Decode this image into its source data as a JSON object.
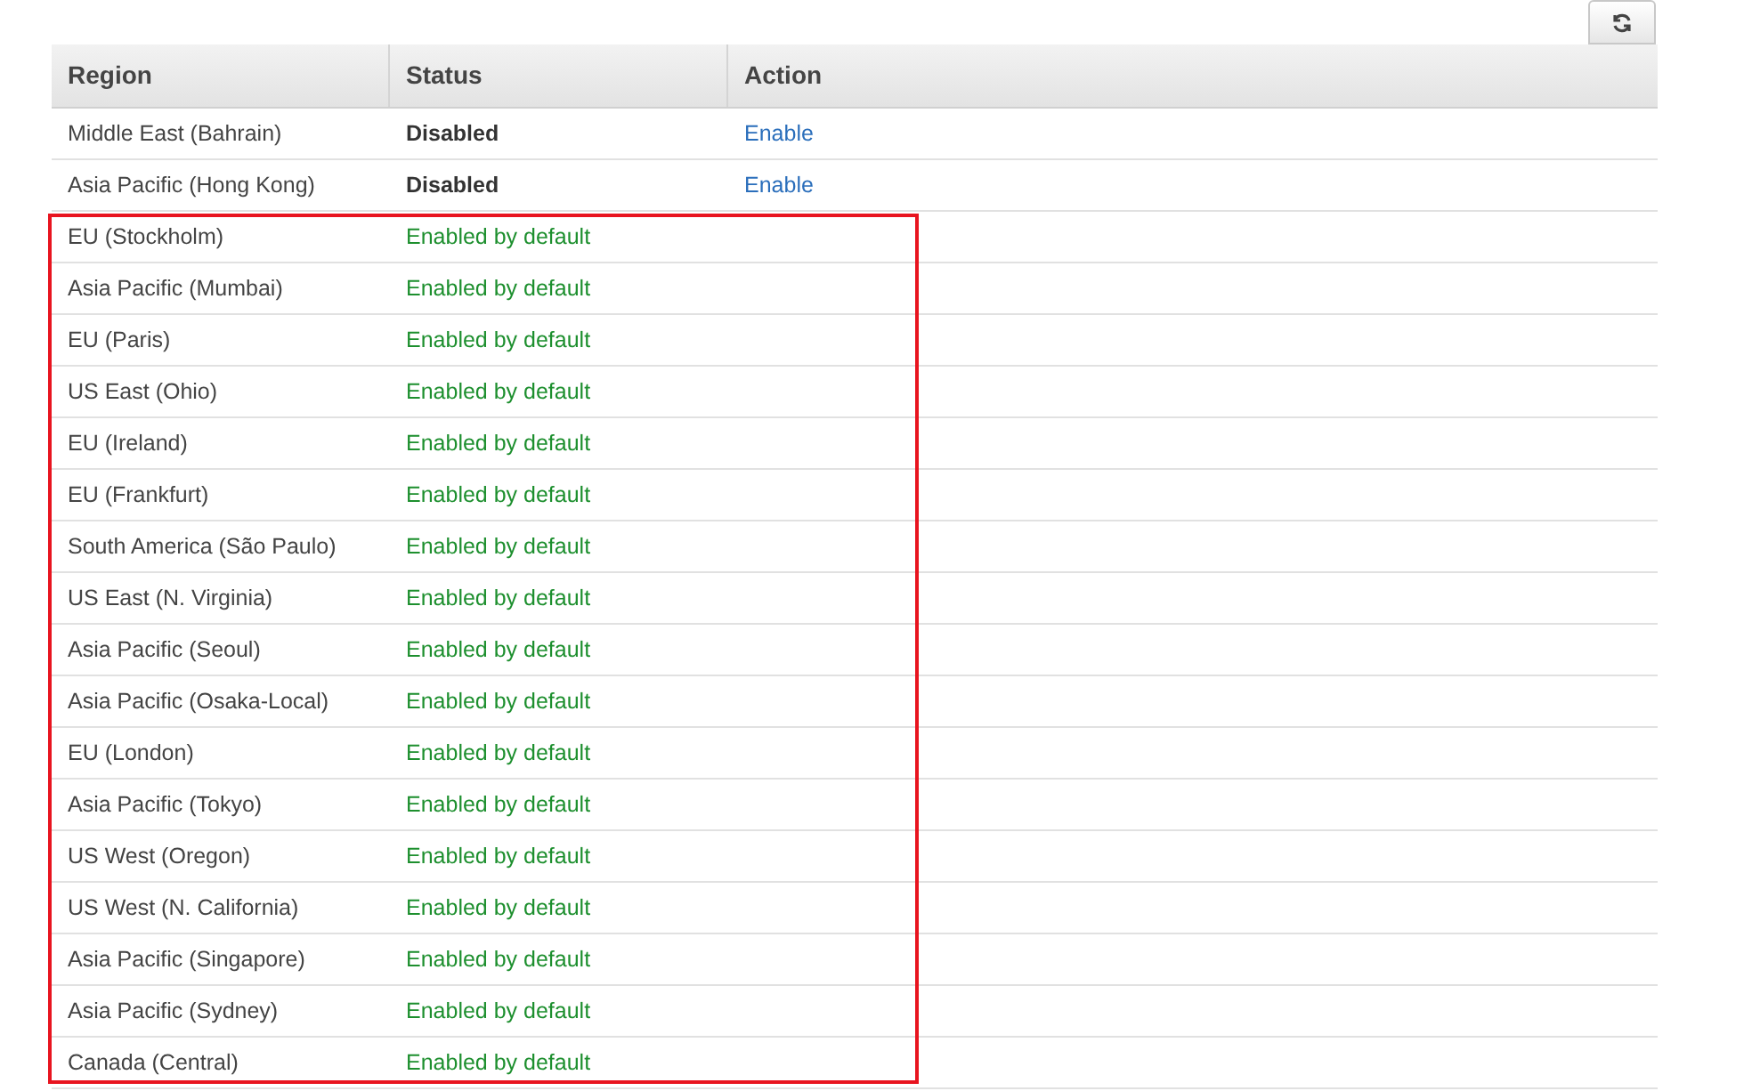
{
  "refresh_button": {
    "kind": "refresh"
  },
  "table": {
    "columns": [
      "Region",
      "Status",
      "Action"
    ],
    "rows": [
      {
        "region": "Middle East (Bahrain)",
        "status": "Disabled",
        "kind": "disabled",
        "action": "Enable"
      },
      {
        "region": "Asia Pacific (Hong Kong)",
        "status": "Disabled",
        "kind": "disabled",
        "action": "Enable"
      }
    ],
    "highlighted_rows": [
      {
        "region": "EU (Stockholm)",
        "status": "Enabled by default",
        "kind": "enabled"
      },
      {
        "region": "Asia Pacific (Mumbai)",
        "status": "Enabled by default",
        "kind": "enabled"
      },
      {
        "region": "EU (Paris)",
        "status": "Enabled by default",
        "kind": "enabled"
      },
      {
        "region": "US East (Ohio)",
        "status": "Enabled by default",
        "kind": "enabled"
      },
      {
        "region": "EU (Ireland)",
        "status": "Enabled by default",
        "kind": "enabled"
      },
      {
        "region": "EU (Frankfurt)",
        "status": "Enabled by default",
        "kind": "enabled"
      },
      {
        "region": "South America (São Paulo)",
        "status": "Enabled by default",
        "kind": "enabled"
      },
      {
        "region": "US East (N. Virginia)",
        "status": "Enabled by default",
        "kind": "enabled"
      },
      {
        "region": "Asia Pacific (Seoul)",
        "status": "Enabled by default",
        "kind": "enabled"
      },
      {
        "region": "Asia Pacific (Osaka-Local)",
        "status": "Enabled by default",
        "kind": "enabled"
      },
      {
        "region": "EU (London)",
        "status": "Enabled by default",
        "kind": "enabled"
      },
      {
        "region": "Asia Pacific (Tokyo)",
        "status": "Enabled by default",
        "kind": "enabled"
      },
      {
        "region": "US West (Oregon)",
        "status": "Enabled by default",
        "kind": "enabled"
      },
      {
        "region": "US West (N. California)",
        "status": "Enabled by default",
        "kind": "enabled"
      },
      {
        "region": "Asia Pacific (Singapore)",
        "status": "Enabled by default",
        "kind": "enabled"
      },
      {
        "region": "Asia Pacific (Sydney)",
        "status": "Enabled by default",
        "kind": "enabled"
      },
      {
        "region": "Canada (Central)",
        "status": "Enabled by default",
        "kind": "enabled"
      }
    ]
  }
}
